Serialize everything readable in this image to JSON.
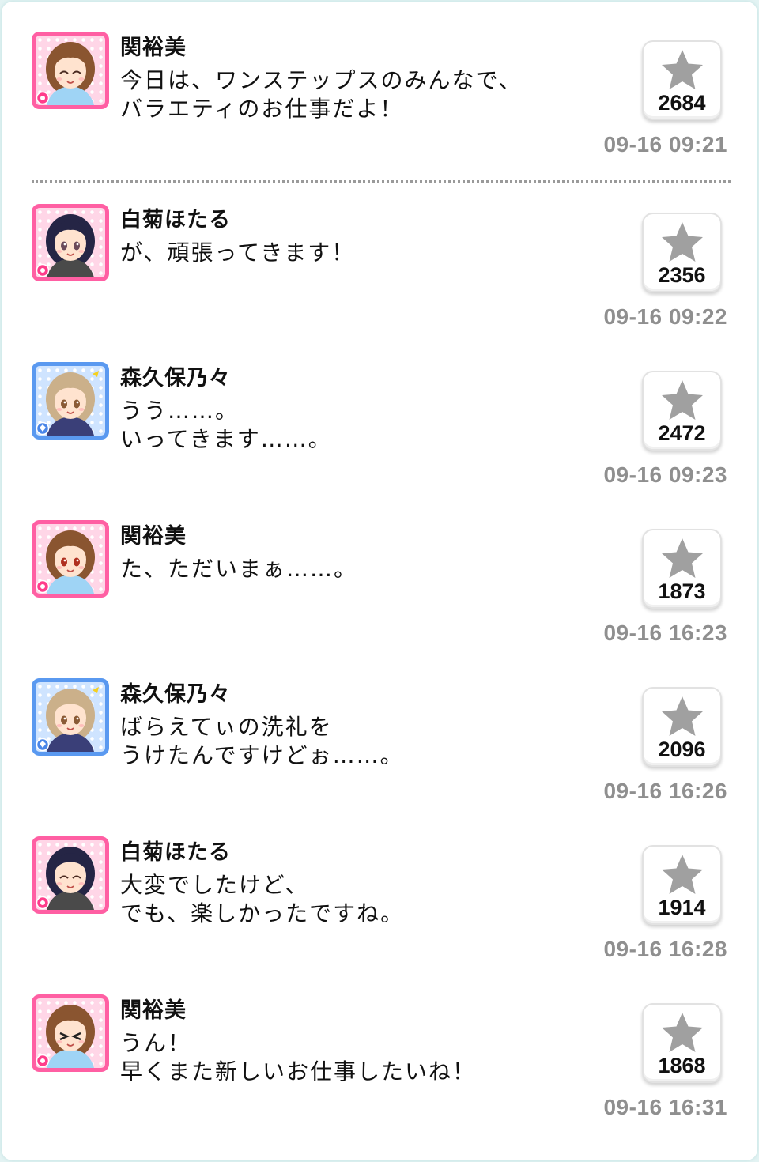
{
  "posts": [
    {
      "name": "関裕美",
      "message": "今日は、ワンステップスのみんなで、\nバラエティのお仕事だよ！",
      "stars": "2684",
      "time": "09-16 09:21",
      "avatar": "pink",
      "hair": "#8a5530",
      "icon": "flower-badge-icon",
      "expression": "smile"
    },
    {
      "name": "白菊ほたる",
      "message": "が、頑張ってきます！",
      "stars": "2356",
      "time": "09-16 09:22",
      "avatar": "pink",
      "hair": "#252545",
      "icon": "flower-badge-icon",
      "expression": "open"
    },
    {
      "name": "森久保乃々",
      "message": "うう……。\nいってきます……。",
      "stars": "2472",
      "time": "09-16 09:23",
      "avatar": "blue",
      "hair": "#cbb08a",
      "icon": "diamond-badge-icon",
      "expression": "open"
    },
    {
      "name": "関裕美",
      "message": "た、ただいまぁ……。",
      "stars": "1873",
      "time": "09-16 16:23",
      "avatar": "pink",
      "hair": "#8a5530",
      "icon": "flower-badge-icon",
      "expression": "open"
    },
    {
      "name": "森久保乃々",
      "message": "ばらえてぃの洗礼を\nうけたんですけどぉ……。",
      "stars": "2096",
      "time": "09-16 16:26",
      "avatar": "blue",
      "hair": "#cbb08a",
      "icon": "diamond-badge-icon",
      "expression": "open"
    },
    {
      "name": "白菊ほたる",
      "message": "大変でしたけど、\nでも、楽しかったですね。",
      "stars": "1914",
      "time": "09-16 16:28",
      "avatar": "pink",
      "hair": "#252545",
      "icon": "flower-badge-icon",
      "expression": "smile"
    },
    {
      "name": "関裕美",
      "message": "うん！\n早くまた新しいお仕事したいね！",
      "stars": "1868",
      "time": "09-16 16:31",
      "avatar": "pink",
      "hair": "#8a5530",
      "icon": "flower-badge-icon",
      "expression": "squint"
    }
  ],
  "colors": {
    "pink_frame": "#ff5fa3",
    "blue_frame": "#5a99f0",
    "star": "#a0a0a0",
    "timestamp": "#8f8f8f"
  }
}
